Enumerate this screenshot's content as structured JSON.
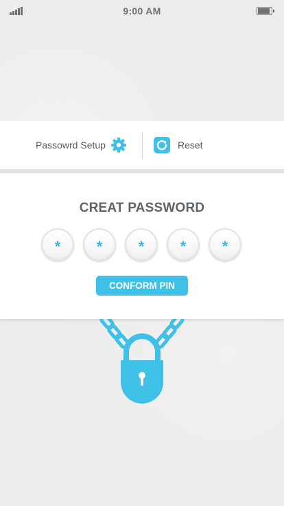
{
  "status_bar": {
    "time": "9:00 AM",
    "signal_icon": "signal-bars-icon",
    "battery_icon": "battery-icon"
  },
  "toolbar": {
    "setup_label": "Passowrd Setup",
    "setup_icon": "gear-icon",
    "reset_label": "Reset",
    "reset_icon": "refresh-icon"
  },
  "card": {
    "title": "CREAT PASSWORD",
    "pins": [
      "*",
      "*",
      "*",
      "*",
      "*"
    ],
    "confirm_label": "CONFORM PIN"
  },
  "illustration": {
    "icon": "padlock-chain-icon"
  },
  "colors": {
    "accent": "#3fc0e6",
    "text": "#555b60",
    "title": "#5d6368",
    "background": "#ececec",
    "panel": "#ffffff"
  }
}
